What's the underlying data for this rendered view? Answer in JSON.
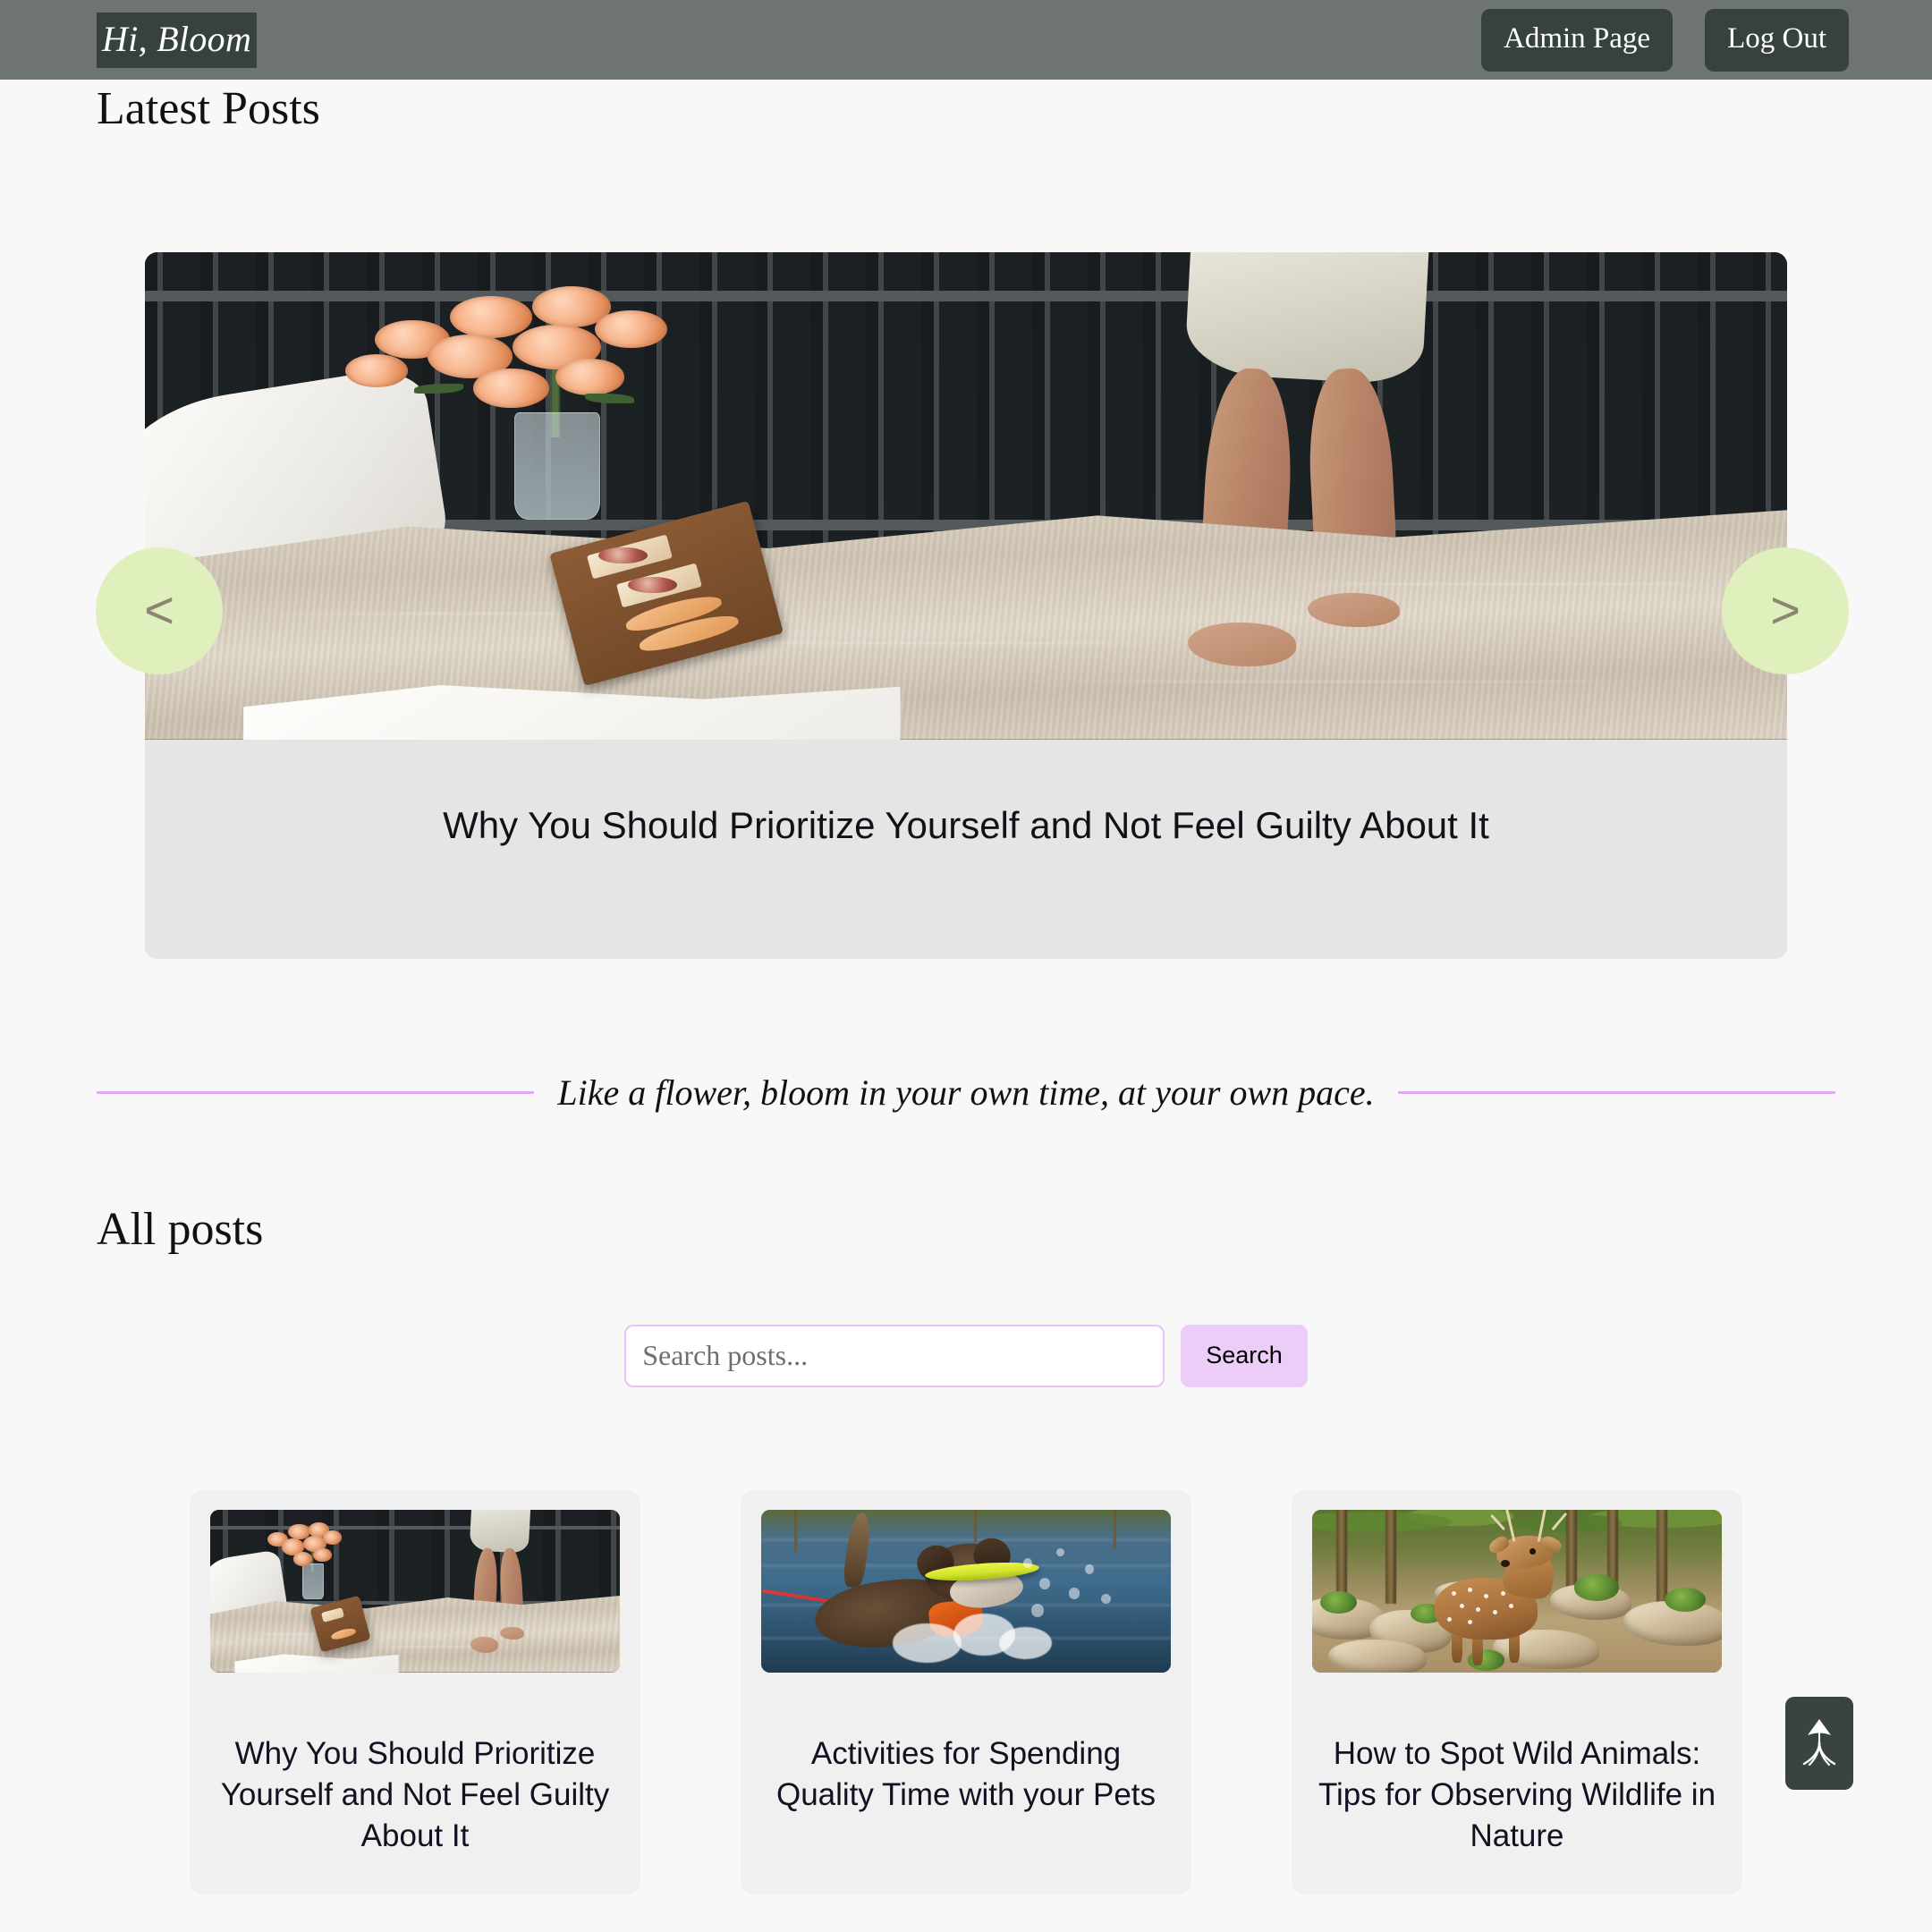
{
  "header": {
    "brand": "Hi, Bloom",
    "admin_label": "Admin Page",
    "logout_label": "Log Out"
  },
  "latest": {
    "title": "Latest Posts",
    "prev_label": "<",
    "next_label": ">",
    "featured_title": "Why You Should Prioritize Yourself and Not Feel Guilty About It"
  },
  "quote": {
    "text": "Like a flower, bloom in your own time, at your own pace."
  },
  "all_posts": {
    "title": "All posts",
    "search_placeholder": "Search posts...",
    "search_value": "",
    "search_button": "Search",
    "cards": [
      {
        "title": "Why You Should Prioritize Yourself and Not Feel Guilty About It"
      },
      {
        "title": "Activities for Spending Quality Time with your Pets"
      },
      {
        "title": "How to Spot Wild Animals: Tips for Observing Wildlife in Nature"
      }
    ]
  },
  "scroll_top": {
    "icon": "scroll-to-top-arrow-icon"
  },
  "colors": {
    "topbar": "#6e7472",
    "button_dark": "#374240",
    "arrow_green": "#dff0bd",
    "accent_purple": "#e0a8f5",
    "search_button": "#eccdf7",
    "card_bg": "#f0f0f0",
    "page_bg": "#f8f8f8"
  }
}
